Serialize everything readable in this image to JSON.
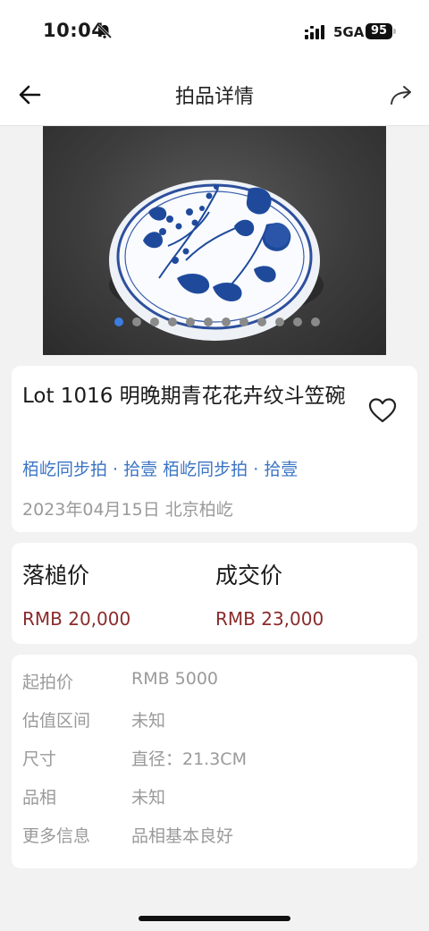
{
  "status_bar": {
    "time": "10:04",
    "network": "5GA",
    "battery": "95"
  },
  "nav": {
    "title": "拍品详情"
  },
  "carousel": {
    "image_alt": "blue and white porcelain bowl",
    "slide_count": 12,
    "active_index": 0
  },
  "lot": {
    "title": "Lot 1016 明晚期青花花卉纹斗笠碗",
    "sale_links": "栢屹同步拍 · 拾壹 栢屹同步拍 · 拾壹",
    "date_place": "2023年04月15日 北京柏屹",
    "favorited": false
  },
  "prices": {
    "hammer_label": "落槌价",
    "hammer_value": "RMB 20,000",
    "deal_label": "成交价",
    "deal_value": "RMB 23,000"
  },
  "info": {
    "rows": [
      {
        "key": "起拍价",
        "value": "RMB 5000"
      },
      {
        "key": "估值区间",
        "value": "未知"
      },
      {
        "key": "尺寸",
        "value": "直径：21.3CM"
      },
      {
        "key": "品相",
        "value": "未知"
      },
      {
        "key": "更多信息",
        "value": "品相基本良好"
      }
    ]
  },
  "colors": {
    "link": "#3b74c4",
    "price": "#8b2b2b",
    "dot_active": "#3b7de0"
  }
}
